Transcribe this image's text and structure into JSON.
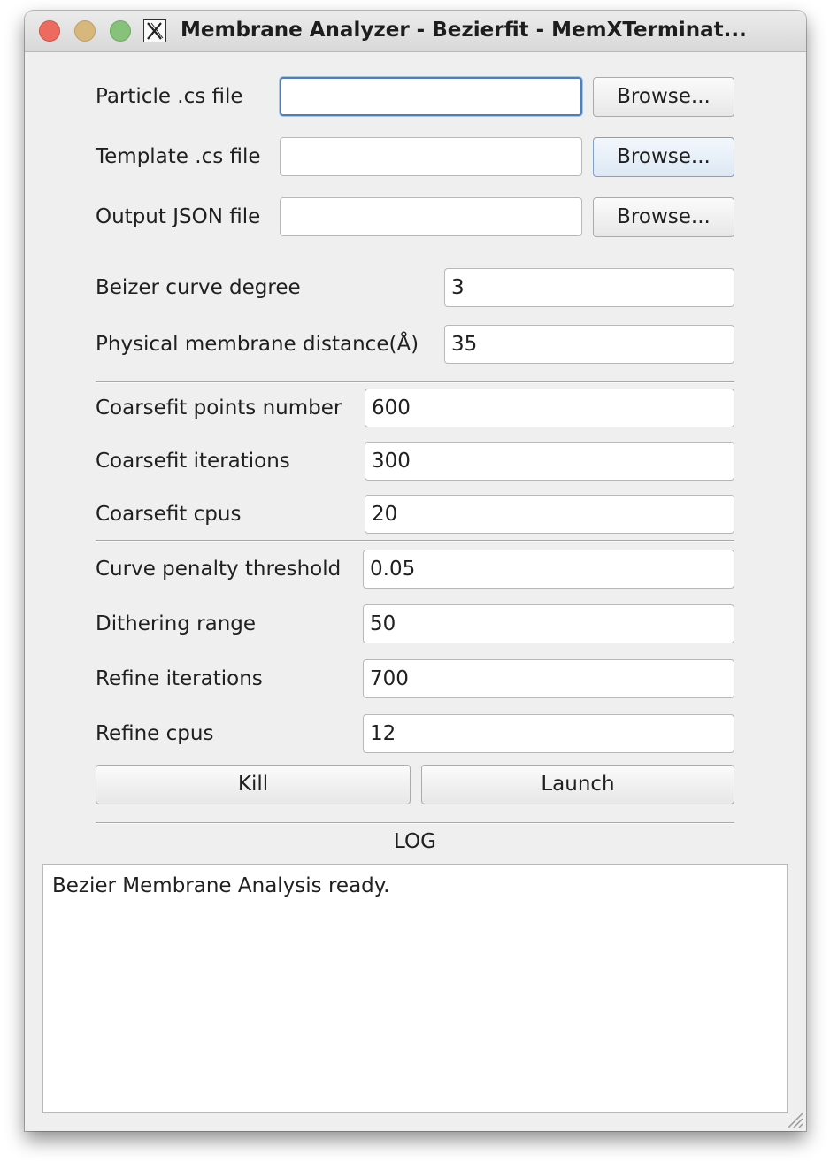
{
  "window": {
    "title": "Membrane Analyzer - Bezierfit - MemXTerminat..."
  },
  "files": {
    "particle": {
      "label": "Particle .cs file",
      "value": "",
      "button": "Browse..."
    },
    "template": {
      "label": "Template .cs file",
      "value": "",
      "button": "Browse..."
    },
    "output": {
      "label": "Output JSON file",
      "value": "",
      "button": "Browse..."
    }
  },
  "params": {
    "bezier_degree": {
      "label": "Beizer curve degree",
      "value": "3"
    },
    "membrane_distance": {
      "label": "Physical membrane distance(Å)",
      "value": "35"
    }
  },
  "coarsefit": {
    "points": {
      "label": "Coarsefit points number",
      "value": "600"
    },
    "iterations": {
      "label": "Coarsefit iterations",
      "value": "300"
    },
    "cpus": {
      "label": "Coarsefit cpus",
      "value": "20"
    }
  },
  "refine": {
    "penalty": {
      "label": "Curve penalty threshold",
      "value": "0.05"
    },
    "dithering": {
      "label": "Dithering range",
      "value": "50"
    },
    "iterations": {
      "label": "Refine iterations",
      "value": "700"
    },
    "cpus": {
      "label": "Refine cpus",
      "value": "12"
    }
  },
  "actions": {
    "kill": "Kill",
    "launch": "Launch"
  },
  "log": {
    "title": "LOG",
    "text": "Bezier Membrane Analysis ready."
  },
  "icons": {
    "close": "close-icon",
    "minimize": "minimize-icon",
    "maximize": "maximize-icon",
    "xquartz": "xquartz-icon",
    "resize": "resize-grip-icon"
  },
  "colors": {
    "close": "#ed6a5e",
    "minimize": "#d8b77c",
    "maximize": "#86c27a",
    "focus": "#4d7fb8"
  }
}
